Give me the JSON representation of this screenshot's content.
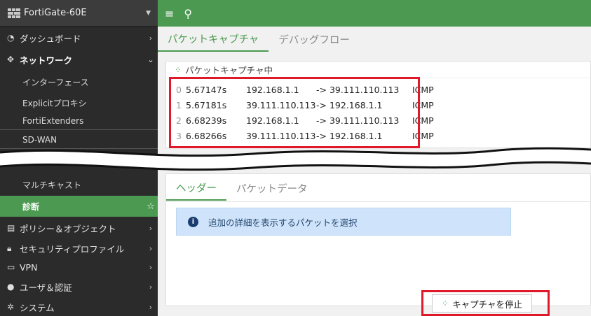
{
  "sidebar": {
    "device": "FortiGate-60E",
    "items": [
      {
        "icon": "dashboard-icon",
        "label": "ダッシュボード"
      },
      {
        "icon": "network-icon",
        "label": "ネットワーク"
      },
      {
        "label": "インターフェース"
      },
      {
        "label": "Explicitプロキシ"
      },
      {
        "label": "FortiExtenders"
      },
      {
        "label": "SD-WAN"
      },
      {
        "label": "マルチキャスト"
      },
      {
        "label": "診断"
      },
      {
        "icon": "policy-icon",
        "label": "ポリシー＆オブジェクト"
      },
      {
        "icon": "lock-icon",
        "label": "セキュリティプロファイル"
      },
      {
        "icon": "monitor-icon",
        "label": "VPN"
      },
      {
        "icon": "user-icon",
        "label": "ユーザ＆認証"
      },
      {
        "icon": "gear-icon",
        "label": "システム"
      }
    ]
  },
  "tabs": {
    "capture": "パケットキャプチャ",
    "debug": "デバッグフロー"
  },
  "capture": {
    "status": "パケットキャプチャ中",
    "packets": [
      {
        "n": "0",
        "time": "5.67147s",
        "src": "192.168.1.1",
        "arrow": "->",
        "dst": "39.111.110.113",
        "proto": "ICMP"
      },
      {
        "n": "1",
        "time": "5.67181s",
        "src": "39.111.110.113",
        "arrow": "->",
        "dst": "192.168.1.1",
        "proto": "ICMP"
      },
      {
        "n": "2",
        "time": "6.68239s",
        "src": "192.168.1.1",
        "arrow": "->",
        "dst": "39.111.110.113",
        "proto": "ICMP"
      },
      {
        "n": "3",
        "time": "6.68266s",
        "src": "39.111.110.113",
        "arrow": "->",
        "dst": "192.168.1.1",
        "proto": "ICMP"
      }
    ]
  },
  "detail_tabs": {
    "header": "ヘッダー",
    "data": "パケットデータ"
  },
  "info_text": "追加の詳細を表示するパケットを選択",
  "stop_button": "キャプチャを停止",
  "colors": {
    "accent": "#4c9a52",
    "sidebar": "#2b2b2b",
    "highlight": "#e0192a"
  }
}
